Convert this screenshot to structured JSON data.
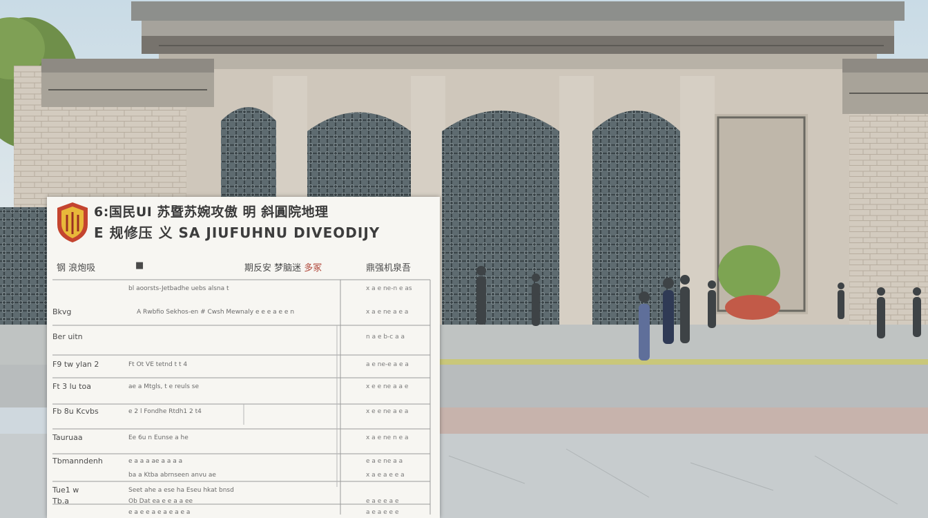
{
  "document": {
    "title_line1": "6:国民UI  苏暨苏婉攻傲 明 斜圓院地理",
    "title_line2": "E 规修压 义  SA JIUFUHNU DIVEODIJY",
    "header": {
      "left": "钢 浪炮吸",
      "dot": "■",
      "mid_prefix": "期反安 梦脑迷",
      "mid_red": "多冢",
      "right": "鼎强机泉吾"
    },
    "rows": [
      {
        "label": "",
        "text": "bl aoorsts-Jetbadhe uebs alsna t",
        "right": "x a e ne-n e as"
      },
      {
        "label": "Bkvg",
        "text": "A  Rwbfio Sekhos-en  #  Cwsh  Mewnaly e e e a e e n",
        "right": "x a e ne a e a"
      },
      {
        "label": "Ber uitn",
        "text": "",
        "right": "n a e b-c a a"
      },
      {
        "label": "F9 tw ylan 2",
        "text": "Ft Ot  VE  tetnd t t 4",
        "right": "a e ne-e a e a"
      },
      {
        "label": "Ft 3 lu toa",
        "text": "ae a Mtgls, t e reuls se",
        "right": "x e e ne a a e"
      },
      {
        "label": "Fb 8u Kcvbs",
        "text": "e  2 l Fondhe Rtdh1 2 t4",
        "right": "x e e ne a e a"
      },
      {
        "label": "Tauruaa",
        "text": "Ee 6u n  Eunse a he",
        "right": "x a e ne n e a"
      },
      {
        "label": "Tbmanndenh",
        "text": "e a a a ae a a a a",
        "right": "e a e ne a a"
      },
      {
        "label": "",
        "text": "ba a Ktba abrnseen anvu ae",
        "right": "x a e a e e a"
      },
      {
        "label": "Tue1  w",
        "text": "Seet ahe a ese ha Eseu hkat bnsd",
        "right": ""
      },
      {
        "label": "Tb.a",
        "text": "Ob Dat ea e e a a ee",
        "right": "e a e e a e"
      },
      {
        "label": "",
        "text": "e a e e a e a e a e a",
        "right": "a e a e e e"
      }
    ]
  }
}
